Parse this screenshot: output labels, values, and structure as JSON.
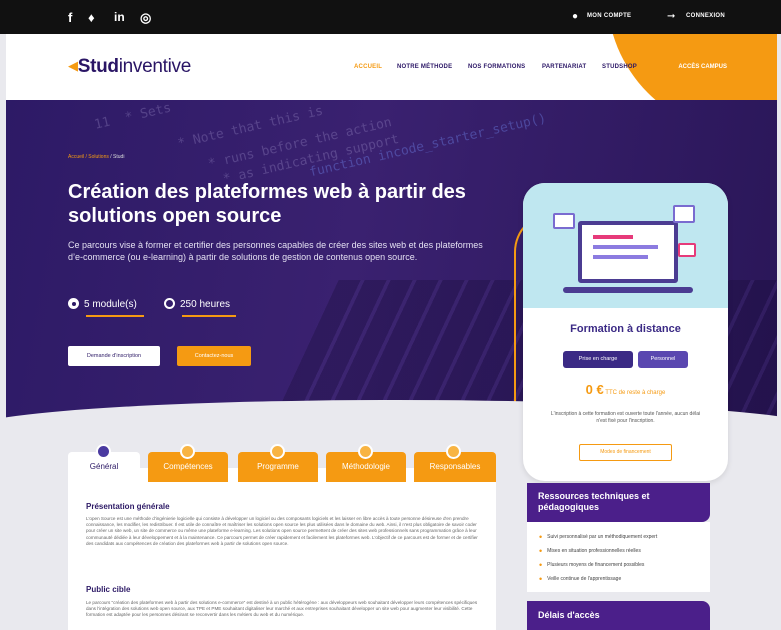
{
  "topbar": {
    "social": [
      "facebook-icon",
      "twitter-icon",
      "linkedin-icon",
      "instagram-icon"
    ],
    "social_glyphs": [
      "f",
      "🐦",
      "in",
      "◎"
    ],
    "account": "MON COMPTE",
    "login": "CONNEXION"
  },
  "header": {
    "logo_bold": "Stud",
    "logo_light": "inventive",
    "nav": [
      "ACCUEIL",
      "NOTRE MÉTHODE",
      "NOS FORMATIONS",
      "PARTENARIAT",
      "STUDSHOP"
    ],
    "campus": "ACCÈS CAMPUS"
  },
  "hero": {
    "breadcrumb_home": "Accueil / Solutions",
    "breadcrumb_current": " / Studi",
    "title": "Création des plateformes web à partir des solutions open source",
    "lead": "Ce parcours vise à former et certifier des personnes capables de créer des sites web et des plateformes d’e-commerce (ou e-learning) à partir de solutions de gestion de contenus open source.",
    "modules": "5 module(s)",
    "hours": "250 heures",
    "btn_inscription": "Demande d'inscription",
    "btn_contact": "Contactez-nous"
  },
  "card": {
    "title": "Formation à distance",
    "pill_prise": "Prise en charge",
    "pill_perso": "Personnel",
    "price_value": "0 €",
    "price_label": " TTC de reste à charge",
    "note": "L'inscription à cette formation est ouverte toute l'année, aucun délai n'est fixé pour l'inscription.",
    "button": "Modes de financement"
  },
  "tabs": [
    "Général",
    "Compétences",
    "Programme",
    "Méthodologie",
    "Responsables"
  ],
  "sections": {
    "presentation_title": "Présentation générale",
    "presentation_text": "L'open Source est une méthode d'ingénierie logicielle qui consiste à développer un logiciel ou des composants logiciels et les laisser en libre accès à toute personne désireuse d'en prendre connaissance, les modifier, les redistribuer. Il est utile de connaître et maîtriser les solutions open source les plus utilisées dans le domaine du web. Ainsi, il n'est plus obligatoire de savoir coder pour créer un site web, un site de commerce ou même une plateforme e-learning. Les solutions open source permettent de créer des sites web professionnels sans programmation grâce à leur communauté dédiée à leur développement et à la maintenance. Ce parcours permet de créer rapidement et facilement les plateformes web. L'objectif de ce parcours est de former et de certifier des candidats aux compétences de création des plateformes web à partir de solutions open source.",
    "public_title": "Public cible",
    "public_text": "Le parcours \"création des plateformes web à partir des solutions e-commerce\" est destiné à un public hétérogène : aux développeurs web souhaitant développer leurs compétences spécifiques dans l'intégration des solutions web open source, aux TPE et PME souhaitant digitaliser leur marché et aux entreprises souhaitant développer un site web pour augmenter leur visibilité. Cette formation est adaptée pour les personnes désirant se reconvertir dans les métiers du web et du numérique."
  },
  "resources": {
    "title": "Ressources techniques et pédagogiques",
    "items": [
      "Suivi personnalisé par un méthodiquement expert",
      "Mises en situation professionnelles réelles",
      "Plusieurs moyens de financement possibles",
      "Veille continue de l'apprentissage"
    ]
  },
  "delais": {
    "title": "Délais d'accès"
  },
  "colors": {
    "brand": "#2d1a66",
    "accent": "#f59a12",
    "purple": "#4b1f8a"
  }
}
